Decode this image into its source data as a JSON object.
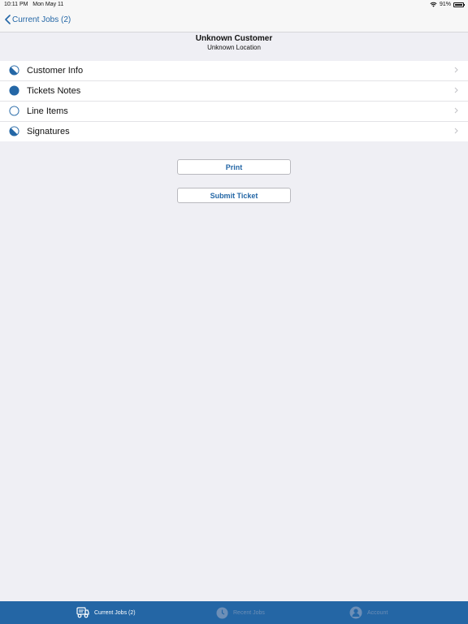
{
  "status_bar": {
    "time": "10:11 PM",
    "date": "Mon May 11",
    "battery": "91%"
  },
  "nav": {
    "back_label": "Current Jobs (2)"
  },
  "header": {
    "title": "Unknown Customer",
    "subtitle": "Unknown Location"
  },
  "sections": [
    {
      "label": "Customer Info",
      "status": "partial"
    },
    {
      "label": "Tickets Notes",
      "status": "complete"
    },
    {
      "label": "Line Items",
      "status": "empty"
    },
    {
      "label": "Signatures",
      "status": "partial"
    }
  ],
  "actions": {
    "print_label": "Print",
    "submit_label": "Submit Ticket"
  },
  "tabs": [
    {
      "label": "Current Jobs (2)",
      "icon": "truck-icon",
      "active": true
    },
    {
      "label": "Recent Jobs",
      "icon": "clock-icon",
      "active": false
    },
    {
      "label": "Account",
      "icon": "person-icon",
      "active": false
    }
  ],
  "colors": {
    "accent": "#2467a6",
    "tab_bar": "#2466a5",
    "background": "#efeff4"
  }
}
